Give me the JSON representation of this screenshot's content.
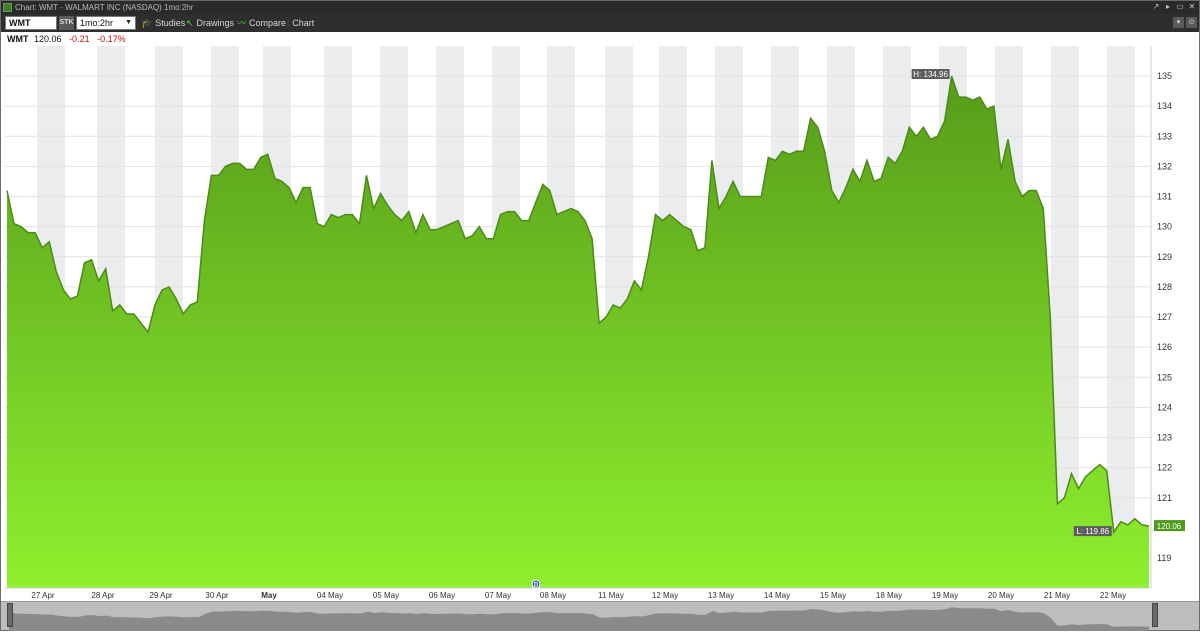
{
  "window": {
    "title": "Chart: WMT - WALMART INC (NASDAQ) 1mo:2hr",
    "buttons": [
      "↗",
      "▸",
      "▭",
      "✕"
    ]
  },
  "toolbar": {
    "symbol": "WMT",
    "type_badge": "STK",
    "period": "1mo:2hr",
    "studies": "Studies",
    "drawings": "Drawings",
    "compare": "Compare",
    "chart": "Chart",
    "right_buttons": [
      "▾",
      "⊙"
    ]
  },
  "quote": {
    "symbol": "WMT",
    "last": "120.06",
    "change": "-0.21",
    "change_pct": "-0.17%"
  },
  "colors": {
    "line": "#4d8a18",
    "area_top": "#569c1a",
    "area_bottom": "#8ef02e",
    "band": "#eaecee",
    "down": "#cc1111"
  },
  "chart_data": {
    "type": "area",
    "ylim": [
      118,
      136
    ],
    "y_ticks": [
      "119",
      "120",
      "121",
      "122",
      "123",
      "124",
      "125",
      "126",
      "127",
      "128",
      "129",
      "130",
      "131",
      "132",
      "133",
      "134",
      "135"
    ],
    "x_labels": [
      "27 Apr",
      "28 Apr",
      "29 Apr",
      "30 Apr",
      "May",
      "04 May",
      "05 May",
      "06 May",
      "07 May",
      "08 May",
      "11 May",
      "12 May",
      "13 May",
      "14 May",
      "15 May",
      "18 May",
      "19 May",
      "20 May",
      "21 May",
      "22 May"
    ],
    "high_label": "H: 134.96",
    "low_label": "L: 119.86",
    "last_label": "120.06",
    "dividend_marker": "D",
    "values": [
      131.2,
      130.1,
      130.0,
      129.8,
      129.8,
      129.3,
      129.5,
      128.5,
      127.9,
      127.6,
      127.7,
      128.8,
      128.9,
      128.2,
      128.6,
      127.2,
      127.4,
      127.1,
      127.1,
      126.8,
      126.5,
      127.4,
      127.9,
      128.0,
      127.6,
      127.1,
      127.4,
      127.5,
      130.2,
      131.7,
      131.7,
      132.0,
      132.1,
      132.1,
      131.9,
      131.9,
      132.3,
      132.4,
      131.6,
      131.5,
      131.3,
      130.8,
      131.3,
      131.3,
      130.1,
      130.0,
      130.4,
      130.3,
      130.4,
      130.4,
      130.1,
      131.7,
      130.6,
      131.1,
      130.7,
      130.4,
      130.2,
      130.5,
      129.8,
      130.4,
      129.9,
      129.9,
      130.0,
      130.1,
      130.2,
      129.6,
      129.7,
      130.0,
      129.6,
      129.6,
      130.4,
      130.5,
      130.5,
      130.2,
      130.2,
      130.8,
      131.4,
      131.2,
      130.4,
      130.5,
      130.6,
      130.5,
      130.2,
      129.6,
      126.8,
      127.0,
      127.4,
      127.3,
      127.6,
      128.2,
      127.9,
      129.0,
      130.4,
      130.2,
      130.4,
      130.2,
      130.0,
      129.9,
      129.2,
      129.3,
      132.2,
      130.6,
      131.0,
      131.5,
      131.0,
      131.0,
      131.0,
      131.0,
      132.3,
      132.2,
      132.5,
      132.4,
      132.5,
      132.5,
      133.6,
      133.3,
      132.5,
      131.2,
      130.8,
      131.3,
      131.9,
      131.5,
      132.2,
      131.5,
      131.6,
      132.3,
      132.1,
      132.5,
      133.3,
      133.0,
      133.3,
      132.9,
      133.0,
      133.5,
      135.0,
      134.3,
      134.3,
      134.2,
      134.3,
      133.9,
      134.0,
      131.9,
      132.9,
      131.5,
      131.0,
      131.2,
      131.2,
      130.6,
      127.0,
      120.8,
      121.0,
      121.8,
      121.3,
      121.7,
      121.9,
      122.1,
      121.9,
      119.86,
      120.2,
      120.1,
      120.3,
      120.1,
      120.06
    ]
  }
}
